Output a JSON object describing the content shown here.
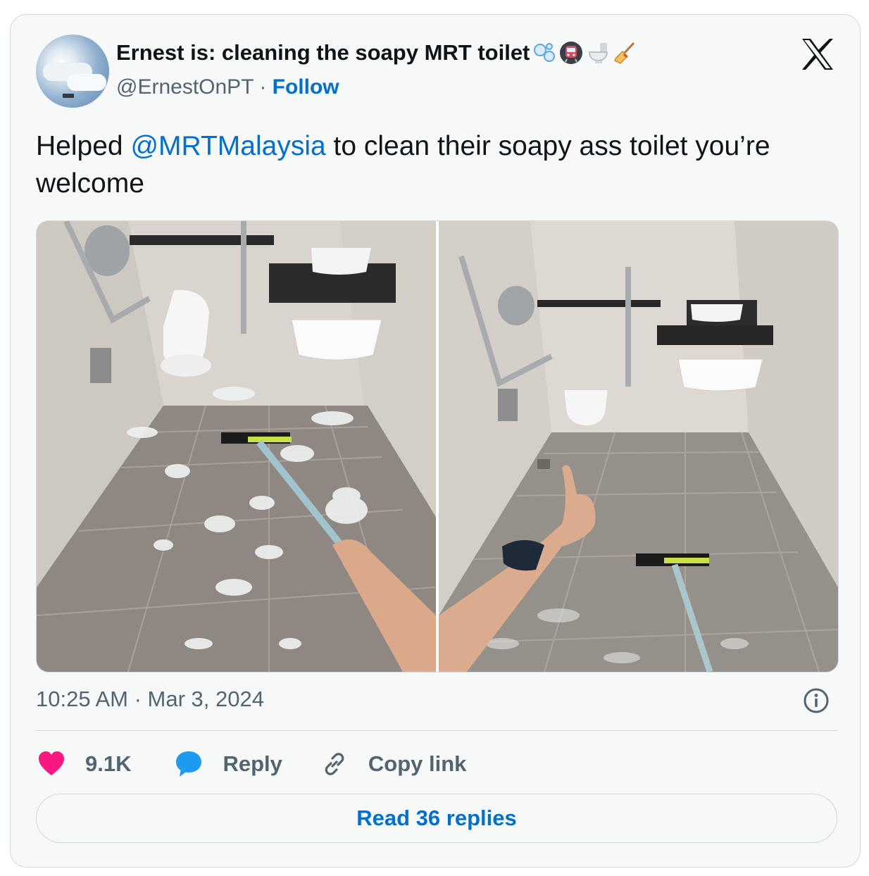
{
  "author": {
    "display_name": "Ernest is: cleaning the soapy MRT toilet",
    "status_emojis": [
      "bubbles-emoji",
      "metro-emoji",
      "toilet-emoji",
      "broom-emoji"
    ],
    "handle": "@ErnestOnPT",
    "separator": " · ",
    "follow_label": "Follow"
  },
  "tweet": {
    "text_before": "Helped ",
    "mention": "@MRTMalaysia",
    "text_after": " to clean their soapy ass toilet you’re welcome",
    "timestamp": "10:25 AM · Mar 3, 2024"
  },
  "actions": {
    "likes": "9.1K",
    "reply_label": "Reply",
    "copy_link_label": "Copy link"
  },
  "footer": {
    "read_replies_label": "Read 36 replies"
  },
  "icons": {
    "platform_logo": "x-logo-icon",
    "info": "info-icon",
    "like": "heart-icon",
    "reply": "speech-bubble-icon",
    "copy": "link-icon"
  },
  "colors": {
    "link": "#006fd6",
    "like": "#f91880",
    "reply": "#1d9bf0",
    "muted": "#536471",
    "border": "#cfd9de",
    "card_bg": "#f7f9f9"
  }
}
